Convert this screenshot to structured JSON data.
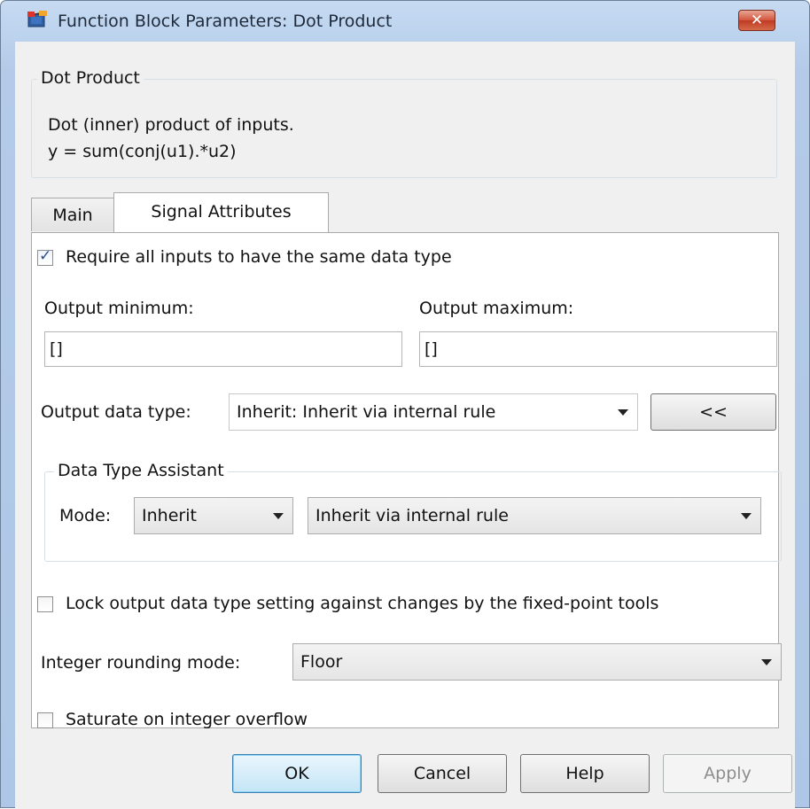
{
  "window": {
    "title": "Function Block Parameters: Dot Product",
    "close_label": "✕"
  },
  "description": {
    "legend": "Dot Product",
    "lines": [
      "Dot (inner) product of inputs.",
      "y = sum(conj(u1).*u2)"
    ]
  },
  "tabs": [
    {
      "label": "Main",
      "active": false
    },
    {
      "label": "Signal Attributes",
      "active": true
    }
  ],
  "signal": {
    "require_same_type": {
      "label": "Require all inputs to have the same data type",
      "checked": true
    },
    "output_min": {
      "label": "Output minimum:",
      "value": "[]"
    },
    "output_max": {
      "label": "Output maximum:",
      "value": "[]"
    },
    "output_data_type": {
      "label": "Output data type:",
      "value": "Inherit: Inherit via internal rule",
      "toggle_label": "<<"
    },
    "assistant": {
      "legend": "Data Type Assistant",
      "mode_label": "Mode:",
      "mode_value": "Inherit",
      "rule_value": "Inherit via internal rule"
    },
    "lock_output": {
      "label": "Lock output data type setting against changes by the fixed-point tools",
      "checked": false
    },
    "rounding": {
      "label": "Integer rounding mode:",
      "value": "Floor"
    },
    "saturate": {
      "label": "Saturate on integer overflow",
      "checked": false
    }
  },
  "buttons": {
    "ok": "OK",
    "cancel": "Cancel",
    "help": "Help",
    "apply": "Apply"
  },
  "colors": {
    "title_bar": "#bcd3ee",
    "close_button": "#c9452d",
    "default_button_border": "#3c7fb1",
    "checkbox_tick": "#2a4d8a"
  }
}
